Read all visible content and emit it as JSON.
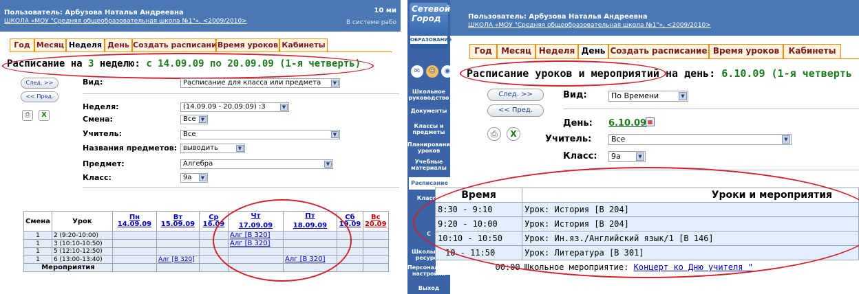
{
  "left": {
    "header": {
      "user": "Пользователь: Арбузова Наталья Андреевна",
      "school": "ШКОЛА «МОУ \"Средняя общеобразовательная школа №1\"»",
      "year": ", <2009/2010>",
      "right_top": "10 ми",
      "right_bottom": "В системе рабо"
    },
    "tabs": [
      "Год",
      "Месяц",
      "Неделя",
      "День",
      "Создать расписание",
      "Время уроков",
      "Кабинеты"
    ],
    "title": {
      "prefix": "Расписание на ",
      "number": "3",
      "mid": " неделю: ",
      "range": "с 14.09.09 по 20.09.09 (1-я четверть)"
    },
    "buttons": {
      "next": "След. >>",
      "prev": "<< Пред."
    },
    "form": {
      "view_label": "Вид:",
      "view_value": "Расписание для класса или предмета",
      "week_label": "Неделя:",
      "week_value": "(14.09.09 - 20.09.09) :3",
      "shift_label": "Смена:",
      "shift_value": "Все",
      "teacher_label": "Учитель:",
      "teacher_value": "Все",
      "subjnames_label": "Названия предметов:",
      "subjnames_value": "выводить",
      "subject_label": "Предмет:",
      "subject_value": "Алгебра",
      "class_label": "Класс:",
      "class_value": "9а"
    },
    "table": {
      "col_shift": "Смена",
      "col_lesson": "Урок",
      "days": [
        {
          "name": "Пн",
          "date": "14.09.09"
        },
        {
          "name": "Вт",
          "date": "15.09.09"
        },
        {
          "name": "Ср",
          "date": "16.09"
        },
        {
          "name": "Чт",
          "date": "17.09.09"
        },
        {
          "name": "Пт",
          "date": "18.09.09"
        },
        {
          "name": "Сб",
          "date": "19.09"
        },
        {
          "name": "Вс",
          "date": "20.09"
        }
      ],
      "rows": [
        {
          "shift": "1",
          "lesson": "2 (9:20-10:00)",
          "cells": [
            "",
            "",
            "",
            "Алг [В 320]",
            "",
            "",
            ""
          ]
        },
        {
          "shift": "1",
          "lesson": "3 (10:10-10:50)",
          "cells": [
            "",
            "",
            "",
            "Алг [В 320]",
            "",
            "",
            ""
          ]
        },
        {
          "shift": "1",
          "lesson": "5 (12:10-12:50)",
          "cells": [
            "",
            "",
            "",
            "",
            "",
            "",
            ""
          ]
        },
        {
          "shift": "1",
          "lesson": "6 (13:00-13:40)",
          "cells": [
            "",
            "Алг [В 320]",
            "",
            "",
            "Алг [В 320]",
            "",
            ""
          ]
        }
      ],
      "events_label": "Мероприятия"
    }
  },
  "right": {
    "logo": {
      "line1": "Сетевой",
      "line2": "Город",
      "line3": "ОБРАЗОВАНИЕ"
    },
    "sidebar": [
      "Школьное руководство",
      "Документы",
      "Классы и предметы",
      "Планирование уроков",
      "Учебные материалы",
      "Расписание",
      "Классы",
      "С",
      "Школьные ресурсы",
      "Персональные настройки",
      "Выход"
    ],
    "header": {
      "user": "Пользователь: Арбузова Наталья Андреевна",
      "school": "ШКОЛА «МОУ \"Средняя общеобразовательная школа №1\"»",
      "year": ", <2009/2010>"
    },
    "tabs": [
      "Год",
      "Месяц",
      "Неделя",
      "День",
      "Создать расписание",
      "Время уроков",
      "Кабинеты"
    ],
    "title": {
      "text": "Расписание уроков и мероприятий на день: ",
      "date": "6.10.09 (1-я четверть"
    },
    "buttons": {
      "next": "След. >>",
      "prev": "<< Пред."
    },
    "form": {
      "view_label": "Вид:",
      "view_value": "По Времени",
      "day_label": "День:",
      "day_value": "6.10.09",
      "teacher_label": "Учитель:",
      "teacher_value": "Все",
      "class_label": "Класс:",
      "class_value": "9а"
    },
    "table": {
      "col_time": "Время",
      "col_events": "Уроки и мероприятия",
      "rows": [
        {
          "time": "8:30 - 9:10",
          "text": "Урок: История [В 204]"
        },
        {
          "time": "9:20 - 10:00",
          "text": "Урок: История [В 204]"
        },
        {
          "time": "10:10 - 10:50",
          "text": "Урок: Ин.яз./Английский язык/1 [В 146]"
        },
        {
          "time": "10 - 11:50",
          "text": "Урок: Литература [В 301]"
        },
        {
          "time": "00:00",
          "text_prefix": "Школьное мероприятие: ",
          "link": "Концерт ко Дню учителя \""
        }
      ]
    }
  },
  "colors": {
    "header": "#4a78b4",
    "tab_border": "#f08c00",
    "tab_text": "#7a1c1c",
    "title_green": "#1c7c1c",
    "ellipse": "#d3202a",
    "sidebar": "#3b64a6",
    "table_row": "#e2eefb"
  },
  "icons": [
    "printer-icon",
    "excel-icon",
    "calendar-icon",
    "mail-icon",
    "users-icon"
  ]
}
